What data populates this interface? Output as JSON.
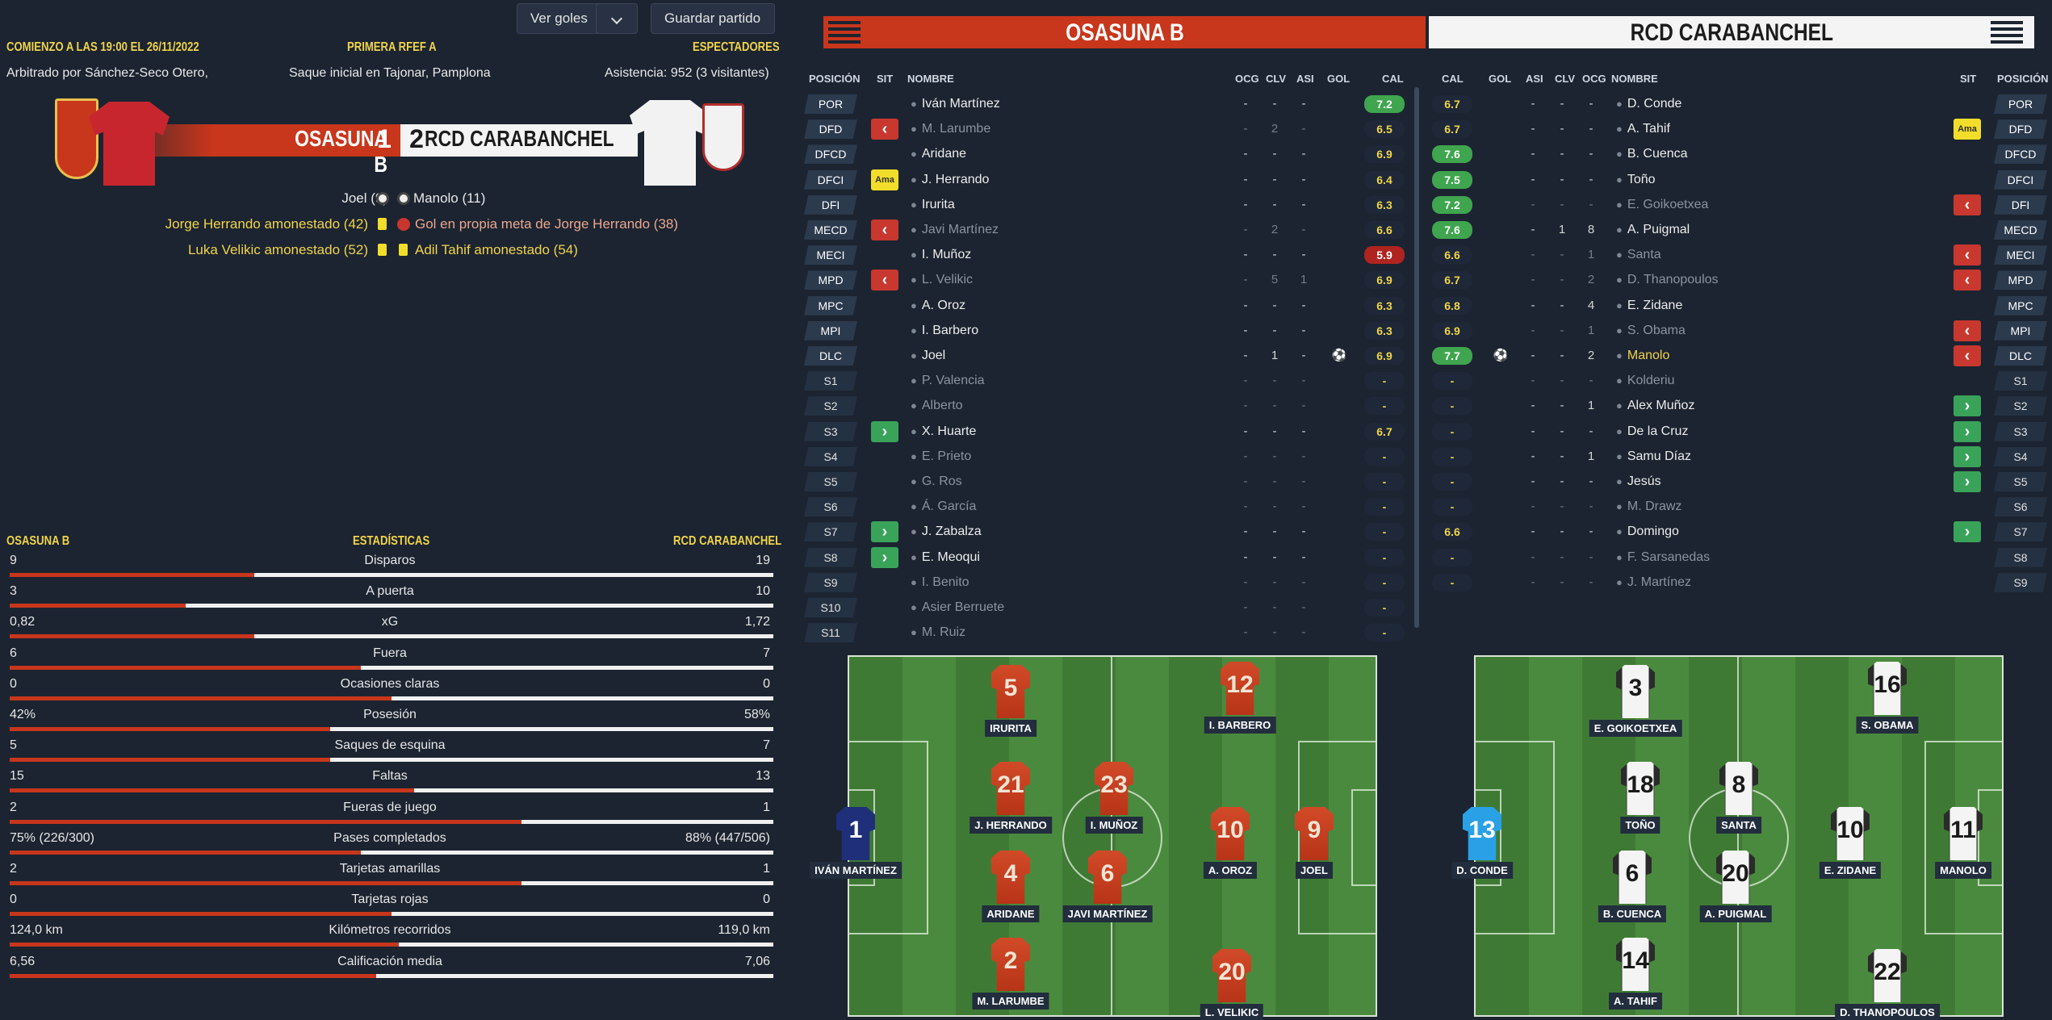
{
  "header": {
    "kickoff": "COMIENZO A LAS 19:00 EL 26/11/2022",
    "competition": "PRIMERA RFEF A",
    "spectators_label": "ESPECTADORES",
    "referee": "Arbitrado por Sánchez-Seco Otero,",
    "venue": "Saque inicial en Tajonar, Pamplona",
    "attendance": "Asistencia: 952 (3 visitantes)",
    "goals_button": "Ver goles",
    "save_button": "Guardar partido"
  },
  "score": {
    "home_team": "OSASUNA B",
    "home_goals": "1",
    "away_goals": "2",
    "away_team": "RCD CARABANCHEL"
  },
  "events": [
    {
      "left": "Joel (9)",
      "right": "Manolo (11)"
    },
    {
      "left": "Jorge Herrando amonestado (42)",
      "right": "Gol en propia meta de Jorge Herrando (38)"
    },
    {
      "left": "Luka Velikic amonestado (52)",
      "right": "Adil Tahif amonestado (54)"
    }
  ],
  "stats": {
    "home_label": "OSASUNA B",
    "title": "ESTADÍSTICAS",
    "away_label": "RCD CARABANCHEL",
    "rows": [
      {
        "label": "Disparos",
        "home": "9",
        "away": "19",
        "home_share": 0.32
      },
      {
        "label": "A puerta",
        "home": "3",
        "away": "10",
        "home_share": 0.23
      },
      {
        "label": "xG",
        "home": "0,82",
        "away": "1,72",
        "home_share": 0.32
      },
      {
        "label": "Fuera",
        "home": "6",
        "away": "7",
        "home_share": 0.46
      },
      {
        "label": "Ocasiones claras",
        "home": "0",
        "away": "0",
        "home_share": 0.5
      },
      {
        "label": "Posesión",
        "home": "42%",
        "away": "58%",
        "home_share": 0.42
      },
      {
        "label": "Saques de esquina",
        "home": "5",
        "away": "7",
        "home_share": 0.42
      },
      {
        "label": "Faltas",
        "home": "15",
        "away": "13",
        "home_share": 0.53
      },
      {
        "label": "Fueras de juego",
        "home": "2",
        "away": "1",
        "home_share": 0.67
      },
      {
        "label": "Pases completados",
        "home": "75% (226/300)",
        "away": "88% (447/506)",
        "home_share": 0.46
      },
      {
        "label": "Tarjetas amarillas",
        "home": "2",
        "away": "1",
        "home_share": 0.67
      },
      {
        "label": "Tarjetas rojas",
        "home": "0",
        "away": "0",
        "home_share": 0.5
      },
      {
        "label": "Kilómetros recorridos",
        "home": "124,0 km",
        "away": "119,0 km",
        "home_share": 0.51
      },
      {
        "label": "Calificación media",
        "home": "6,56",
        "away": "7,06",
        "home_share": 0.48
      }
    ]
  },
  "lineups": {
    "home_title": "OSASUNA B",
    "away_title": "RCD CARABANCHEL",
    "headers_home": {
      "pos": "POSICIÓN",
      "sit": "SIT",
      "name": "NOMBRE",
      "ocg": "OCG",
      "clv": "CLV",
      "asi": "ASI",
      "gol": "GOL",
      "cal": "CAL"
    },
    "headers_away": {
      "cal": "CAL",
      "gol": "GOL",
      "asi": "ASI",
      "clv": "CLV",
      "ocg": "OCG",
      "name": "NOMBRE",
      "sit": "SIT",
      "pos": "POSICIÓN"
    },
    "home": [
      {
        "pos": "POR",
        "sit": "",
        "name": "Iván Martínez",
        "ocg": "-",
        "clv": "-",
        "asi": "-",
        "gol": "",
        "cal": "7.2",
        "rc": "g",
        "dim": false
      },
      {
        "pos": "DFD",
        "sit": "out",
        "name": "M. Larumbe",
        "ocg": "-",
        "clv": "2",
        "asi": "-",
        "gol": "",
        "cal": "6.5",
        "rc": "n",
        "dim": true
      },
      {
        "pos": "DFCD",
        "sit": "",
        "name": "Aridane",
        "ocg": "-",
        "clv": "-",
        "asi": "-",
        "gol": "",
        "cal": "6.9",
        "rc": "n",
        "dim": false
      },
      {
        "pos": "DFCI",
        "sit": "Ama",
        "name": "J. Herrando",
        "ocg": "-",
        "clv": "-",
        "asi": "-",
        "gol": "",
        "cal": "6.4",
        "rc": "n",
        "dim": false
      },
      {
        "pos": "DFI",
        "sit": "",
        "name": "Irurita",
        "ocg": "-",
        "clv": "-",
        "asi": "-",
        "gol": "",
        "cal": "6.3",
        "rc": "n",
        "dim": false
      },
      {
        "pos": "MECD",
        "sit": "out",
        "name": "Javi Martínez",
        "ocg": "-",
        "clv": "2",
        "asi": "-",
        "gol": "",
        "cal": "6.6",
        "rc": "n",
        "dim": true
      },
      {
        "pos": "MECI",
        "sit": "",
        "name": "I. Muñoz",
        "ocg": "-",
        "clv": "-",
        "asi": "-",
        "gol": "",
        "cal": "5.9",
        "rc": "r",
        "dim": false
      },
      {
        "pos": "MPD",
        "sit": "out",
        "name": "L. Velikic",
        "ocg": "-",
        "clv": "5",
        "asi": "1",
        "gol": "",
        "cal": "6.9",
        "rc": "n",
        "dim": true
      },
      {
        "pos": "MPC",
        "sit": "",
        "name": "A. Oroz",
        "ocg": "-",
        "clv": "-",
        "asi": "-",
        "gol": "",
        "cal": "6.3",
        "rc": "n",
        "dim": false
      },
      {
        "pos": "MPI",
        "sit": "",
        "name": "I. Barbero",
        "ocg": "-",
        "clv": "-",
        "asi": "-",
        "gol": "",
        "cal": "6.3",
        "rc": "n",
        "dim": false
      },
      {
        "pos": "DLC",
        "sit": "",
        "name": "Joel",
        "ocg": "-",
        "clv": "1",
        "asi": "-",
        "gol": "⚽",
        "cal": "6.9",
        "rc": "n",
        "dim": false
      },
      {
        "pos": "S1",
        "sit": "",
        "name": "P. Valencia",
        "ocg": "-",
        "clv": "-",
        "asi": "-",
        "gol": "",
        "cal": "-",
        "rc": "n",
        "dim": true
      },
      {
        "pos": "S2",
        "sit": "",
        "name": "Alberto",
        "ocg": "-",
        "clv": "-",
        "asi": "-",
        "gol": "",
        "cal": "-",
        "rc": "n",
        "dim": true
      },
      {
        "pos": "S3",
        "sit": "in",
        "name": "X. Huarte",
        "ocg": "-",
        "clv": "-",
        "asi": "-",
        "gol": "",
        "cal": "6.7",
        "rc": "n",
        "dim": false
      },
      {
        "pos": "S4",
        "sit": "",
        "name": "E. Prieto",
        "ocg": "-",
        "clv": "-",
        "asi": "-",
        "gol": "",
        "cal": "-",
        "rc": "n",
        "dim": true
      },
      {
        "pos": "S5",
        "sit": "",
        "name": "G. Ros",
        "ocg": "-",
        "clv": "-",
        "asi": "-",
        "gol": "",
        "cal": "-",
        "rc": "n",
        "dim": true
      },
      {
        "pos": "S6",
        "sit": "",
        "name": "Á. García",
        "ocg": "-",
        "clv": "-",
        "asi": "-",
        "gol": "",
        "cal": "-",
        "rc": "n",
        "dim": true
      },
      {
        "pos": "S7",
        "sit": "in",
        "name": "J. Zabalza",
        "ocg": "-",
        "clv": "-",
        "asi": "-",
        "gol": "",
        "cal": "-",
        "rc": "n",
        "dim": false
      },
      {
        "pos": "S8",
        "sit": "in",
        "name": "E. Meoqui",
        "ocg": "-",
        "clv": "-",
        "asi": "-",
        "gol": "",
        "cal": "-",
        "rc": "n",
        "dim": false
      },
      {
        "pos": "S9",
        "sit": "",
        "name": "I. Benito",
        "ocg": "-",
        "clv": "-",
        "asi": "-",
        "gol": "",
        "cal": "-",
        "rc": "n",
        "dim": true
      },
      {
        "pos": "S10",
        "sit": "",
        "name": "Asier Berruete",
        "ocg": "-",
        "clv": "-",
        "asi": "-",
        "gol": "",
        "cal": "-",
        "rc": "n",
        "dim": true
      },
      {
        "pos": "S11",
        "sit": "",
        "name": "M. Ruiz",
        "ocg": "-",
        "clv": "-",
        "asi": "-",
        "gol": "",
        "cal": "-",
        "rc": "n",
        "dim": true
      }
    ],
    "away": [
      {
        "pos": "POR",
        "sit": "",
        "name": "D. Conde",
        "ocg": "-",
        "clv": "-",
        "asi": "-",
        "gol": "",
        "cal": "6.7",
        "rc": "n",
        "dim": false
      },
      {
        "pos": "DFD",
        "sit": "Ama",
        "name": "A. Tahif",
        "ocg": "-",
        "clv": "-",
        "asi": "-",
        "gol": "",
        "cal": "6.7",
        "rc": "n",
        "dim": false
      },
      {
        "pos": "DFCD",
        "sit": "",
        "name": "B. Cuenca",
        "ocg": "-",
        "clv": "-",
        "asi": "-",
        "gol": "",
        "cal": "7.6",
        "rc": "g",
        "dim": false
      },
      {
        "pos": "DFCI",
        "sit": "",
        "name": "Toño",
        "ocg": "-",
        "clv": "-",
        "asi": "-",
        "gol": "",
        "cal": "7.5",
        "rc": "g",
        "dim": false
      },
      {
        "pos": "DFI",
        "sit": "out",
        "name": "E. Goikoetxea",
        "ocg": "-",
        "clv": "-",
        "asi": "-",
        "gol": "",
        "cal": "7.2",
        "rc": "g",
        "dim": true
      },
      {
        "pos": "MECD",
        "sit": "",
        "name": "A. Puigmal",
        "ocg": "-",
        "clv": "8",
        "asi": "1",
        "gol": "",
        "cal": "7.6",
        "rc": "g",
        "dim": false
      },
      {
        "pos": "MECI",
        "sit": "out",
        "name": "Santa",
        "ocg": "-",
        "clv": "1",
        "asi": "-",
        "gol": "",
        "cal": "6.6",
        "rc": "n",
        "dim": true
      },
      {
        "pos": "MPD",
        "sit": "out",
        "name": "D. Thanopoulos",
        "ocg": "-",
        "clv": "2",
        "asi": "-",
        "gol": "",
        "cal": "6.7",
        "rc": "n",
        "dim": true
      },
      {
        "pos": "MPC",
        "sit": "",
        "name": "E. Zidane",
        "ocg": "-",
        "clv": "4",
        "asi": "-",
        "gol": "",
        "cal": "6.8",
        "rc": "n",
        "dim": false
      },
      {
        "pos": "MPI",
        "sit": "out",
        "name": "S. Obama",
        "ocg": "-",
        "clv": "1",
        "asi": "-",
        "gol": "",
        "cal": "6.9",
        "rc": "n",
        "dim": true
      },
      {
        "pos": "DLC",
        "sit": "out",
        "name": "Manolo",
        "ocg": "-",
        "clv": "2",
        "asi": "-",
        "gol": "⚽",
        "cal": "7.7",
        "rc": "g",
        "dim": false,
        "gold": true
      },
      {
        "pos": "S1",
        "sit": "",
        "name": "Kolderiu",
        "ocg": "-",
        "clv": "-",
        "asi": "-",
        "gol": "",
        "cal": "-",
        "rc": "n",
        "dim": true
      },
      {
        "pos": "S2",
        "sit": "in",
        "name": "Alex Muñoz",
        "ocg": "-",
        "clv": "1",
        "asi": "-",
        "gol": "",
        "cal": "-",
        "rc": "n",
        "dim": false
      },
      {
        "pos": "S3",
        "sit": "in",
        "name": "De la Cruz",
        "ocg": "-",
        "clv": "-",
        "asi": "-",
        "gol": "",
        "cal": "-",
        "rc": "n",
        "dim": false
      },
      {
        "pos": "S4",
        "sit": "in",
        "name": "Samu Díaz",
        "ocg": "-",
        "clv": "1",
        "asi": "-",
        "gol": "",
        "cal": "-",
        "rc": "n",
        "dim": false
      },
      {
        "pos": "S5",
        "sit": "in",
        "name": "Jesús",
        "ocg": "-",
        "clv": "-",
        "asi": "-",
        "gol": "",
        "cal": "-",
        "rc": "n",
        "dim": false
      },
      {
        "pos": "S6",
        "sit": "",
        "name": "M. Drawz",
        "ocg": "-",
        "clv": "-",
        "asi": "-",
        "gol": "",
        "cal": "-",
        "rc": "n",
        "dim": true
      },
      {
        "pos": "S7",
        "sit": "in",
        "name": "Domingo",
        "ocg": "-",
        "clv": "-",
        "asi": "-",
        "gol": "",
        "cal": "6.6",
        "rc": "n",
        "dim": false
      },
      {
        "pos": "S8",
        "sit": "",
        "name": "F. Sarsanedas",
        "ocg": "-",
        "clv": "-",
        "asi": "-",
        "gol": "",
        "cal": "-",
        "rc": "n",
        "dim": true
      },
      {
        "pos": "S9",
        "sit": "",
        "name": "J. Martínez",
        "ocg": "-",
        "clv": "-",
        "asi": "-",
        "gol": "",
        "cal": "-",
        "rc": "n",
        "dim": true
      }
    ]
  },
  "pitch_home": [
    {
      "n": "5",
      "name": "IRURITA"
    },
    {
      "n": "12",
      "name": "I. BARBERO"
    },
    {
      "n": "21",
      "name": "J. HERRANDO"
    },
    {
      "n": "23",
      "name": "I. MUÑOZ"
    },
    {
      "n": "1",
      "name": "IVÁN MARTÍNEZ"
    },
    {
      "n": "10",
      "name": "A. OROZ"
    },
    {
      "n": "9",
      "name": "JOEL"
    },
    {
      "n": "4",
      "name": "ARIDANE"
    },
    {
      "n": "6",
      "name": "JAVI MARTÍNEZ"
    },
    {
      "n": "2",
      "name": "M. LARUMBE"
    },
    {
      "n": "20",
      "name": "L. VELIKIC"
    }
  ],
  "pitch_away": [
    {
      "n": "3",
      "name": "E. GOIKOETXEA"
    },
    {
      "n": "16",
      "name": "S. OBAMA"
    },
    {
      "n": "18",
      "name": "TOÑO"
    },
    {
      "n": "8",
      "name": "SANTA"
    },
    {
      "n": "13",
      "name": "D. CONDE"
    },
    {
      "n": "10",
      "name": "E. ZIDANE"
    },
    {
      "n": "11",
      "name": "MANOLO"
    },
    {
      "n": "6",
      "name": "B. CUENCA"
    },
    {
      "n": "20",
      "name": "A. PUIGMAL"
    },
    {
      "n": "14",
      "name": "A. TAHIF"
    },
    {
      "n": "22",
      "name": "D. THANOPOULOS"
    }
  ],
  "colors": {
    "home": "#c8361c",
    "away": "#f4f4f4",
    "accent": "#f0d44a",
    "background": "#1c2431"
  },
  "icons": {
    "ball": "soccer-ball-icon",
    "yellow_card": "yellow-card-icon",
    "own_goal": "own-goal-icon",
    "dropdown": "chevron-down-icon",
    "player": "person-icon"
  }
}
